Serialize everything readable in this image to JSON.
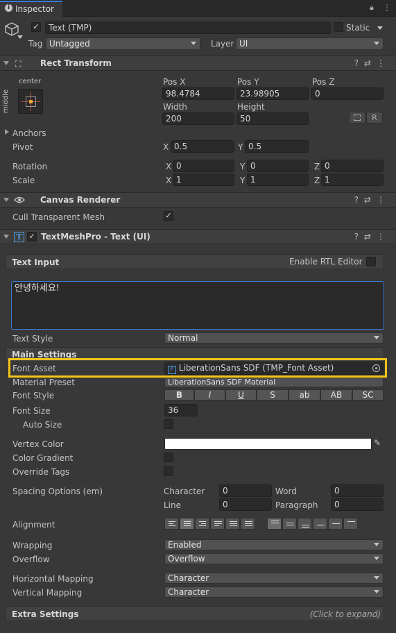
{
  "tab": {
    "label": "Inspector"
  },
  "object": {
    "name": "Text (TMP)",
    "static_label": "Static",
    "tag_label": "Tag",
    "tag_value": "Untagged",
    "layer_label": "Layer",
    "layer_value": "UI"
  },
  "rect_transform": {
    "title": "Rect Transform",
    "anchor_h": "center",
    "anchor_v": "middle",
    "pos_x_label": "Pos X",
    "pos_y_label": "Pos Y",
    "pos_z_label": "Pos Z",
    "pos_x": "98.4784",
    "pos_y": "23.98905",
    "pos_z": "0",
    "width_label": "Width",
    "height_label": "Height",
    "width": "200",
    "height": "50",
    "raw_label": "R",
    "anchors_label": "Anchors",
    "pivot_label": "Pivot",
    "pivot_x": "0.5",
    "pivot_y": "0.5",
    "rotation_label": "Rotation",
    "rot_x": "0",
    "rot_y": "0",
    "rot_z": "0",
    "scale_label": "Scale",
    "scale_x": "1",
    "scale_y": "1",
    "scale_z": "1",
    "x": "X",
    "y": "Y",
    "z": "Z"
  },
  "canvas_renderer": {
    "title": "Canvas Renderer",
    "cull_label": "Cull Transparent Mesh"
  },
  "tmp": {
    "title": "TextMeshPro - Text (UI)",
    "text_input_label": "Text Input",
    "rtl_label": "Enable RTL Editor",
    "text_value": "안녕하세요!",
    "text_style_label": "Text Style",
    "text_style_value": "Normal",
    "main_settings_label": "Main Settings",
    "font_asset_label": "Font Asset",
    "font_asset_value": "LiberationSans SDF (TMP_Font Asset)",
    "material_preset_label": "Material Preset",
    "material_preset_value": "LiberationSans SDF Material",
    "font_style_label": "Font Style",
    "font_style_buttons": [
      "B",
      "I",
      "U",
      "S",
      "ab",
      "AB",
      "SC"
    ],
    "font_size_label": "Font Size",
    "font_size_value": "36",
    "auto_size_label": "Auto Size",
    "vertex_color_label": "Vertex Color",
    "color_gradient_label": "Color Gradient",
    "override_tags_label": "Override Tags",
    "spacing_label": "Spacing Options (em)",
    "character_label": "Character",
    "character_value": "0",
    "word_label": "Word",
    "word_value": "0",
    "line_label": "Line",
    "line_value": "0",
    "paragraph_label": "Paragraph",
    "paragraph_value": "0",
    "alignment_label": "Alignment",
    "wrapping_label": "Wrapping",
    "wrapping_value": "Enabled",
    "overflow_label": "Overflow",
    "overflow_value": "Overflow",
    "hmap_label": "Horizontal Mapping",
    "hmap_value": "Character",
    "vmap_label": "Vertical Mapping",
    "vmap_value": "Character",
    "extra_label": "Extra Settings",
    "extra_hint": "(Click to expand)"
  },
  "colors": {
    "highlight": "#f5c518",
    "vertex_color": "#ffffff",
    "accent": "#3a7bd5"
  }
}
